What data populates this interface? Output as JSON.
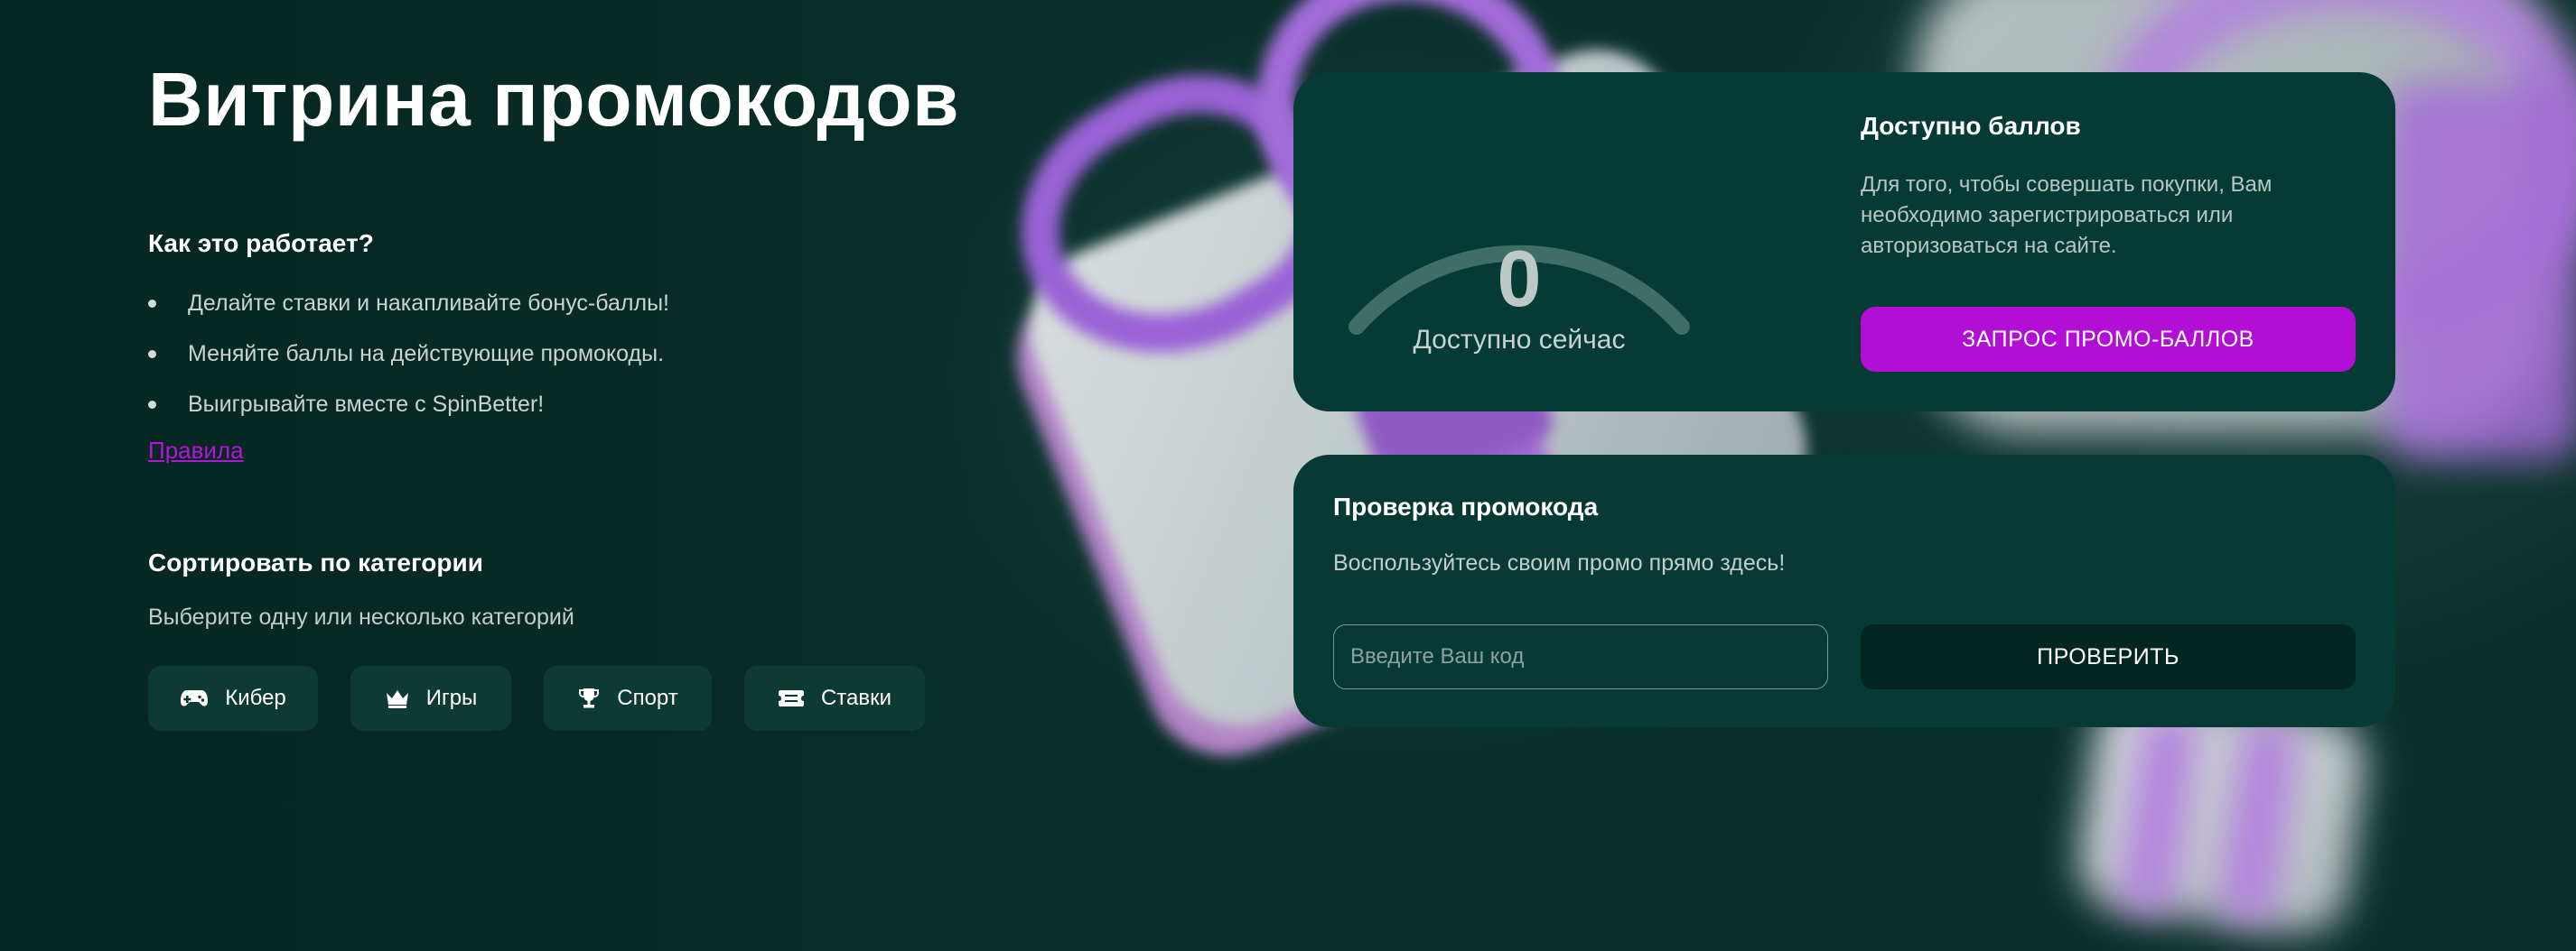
{
  "page": {
    "title": "Витрина промокодов"
  },
  "how_it_works": {
    "title": "Как это работает?",
    "steps": [
      "Делайте ставки и накапливайте бонус-баллы!",
      "Меняйте баллы на действующие промокоды.",
      "Выигрывайте вместе с SpinBetter!"
    ],
    "rules_link": "Правила"
  },
  "sort": {
    "title": "Сортировать по категории",
    "subtitle": "Выберите одну или несколько категорий",
    "categories": [
      {
        "label": "Кибер",
        "icon": "gamepad-icon"
      },
      {
        "label": "Игры",
        "icon": "crown-icon"
      },
      {
        "label": "Спорт",
        "icon": "trophy-icon"
      },
      {
        "label": "Ставки",
        "icon": "ticket-icon"
      }
    ]
  },
  "points_card": {
    "gauge_value": "0",
    "gauge_fill_fraction": 0,
    "gauge_caption": "Доступно сейчас",
    "title": "Доступно баллов",
    "description": "Для того, чтобы совершать покупки, Вам необходимо зарегистрироваться или авторизоваться на сайте.",
    "button_label": "ЗАПРОС ПРОМО-БАЛЛОВ"
  },
  "promo_check": {
    "title": "Проверка промокода",
    "subtitle": "Воспользуйтесь своим промо прямо здесь!",
    "input_placeholder": "Введите Ваш код",
    "input_value": "",
    "button_label": "ПРОВЕРИТЬ"
  },
  "colors": {
    "background": "#062a25",
    "card": "#063a34",
    "accent_purple": "#b20fd6",
    "link_purple": "#b315d9",
    "dark_button": "#032621"
  }
}
